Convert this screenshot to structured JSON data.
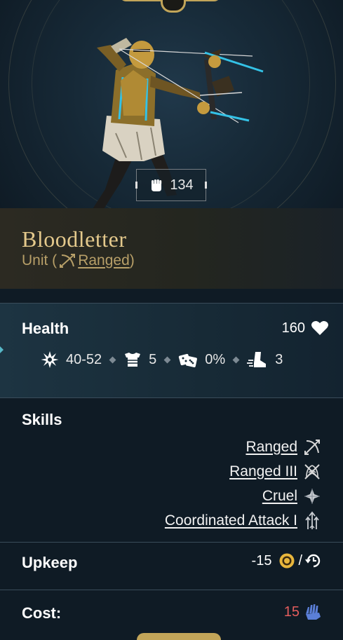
{
  "unit": {
    "power": "134",
    "name": "Bloodletter",
    "type_prefix": "Unit (",
    "type_link": "Ranged",
    "type_suffix": ")"
  },
  "health": {
    "label": "Health",
    "value": "160",
    "damage": "40-52",
    "armor": "5",
    "chance": "0%",
    "movement": "3"
  },
  "skills": {
    "label": "Skills",
    "items": [
      {
        "name": "Ranged",
        "icon": "bow-icon"
      },
      {
        "name": "Ranged III",
        "icon": "bow-chevrons-icon"
      },
      {
        "name": "Cruel",
        "icon": "cruel-blades-icon"
      },
      {
        "name": "Coordinated Attack I",
        "icon": "coordinated-arrows-icon"
      }
    ]
  },
  "upkeep": {
    "label": "Upkeep",
    "value": "-15",
    "separator": "/",
    "gold_icon": "gold-coin-icon",
    "turn_icon": "turn-clock-icon"
  },
  "cost": {
    "label": "Cost:",
    "value": "15",
    "icon": "population-hand-icon"
  },
  "colors": {
    "gold": "#c2a559",
    "name": "#e4c98c",
    "cost_red": "#e35d5d",
    "accent_cyan": "#57b8c8",
    "pop_blue": "#5b7fd8"
  }
}
